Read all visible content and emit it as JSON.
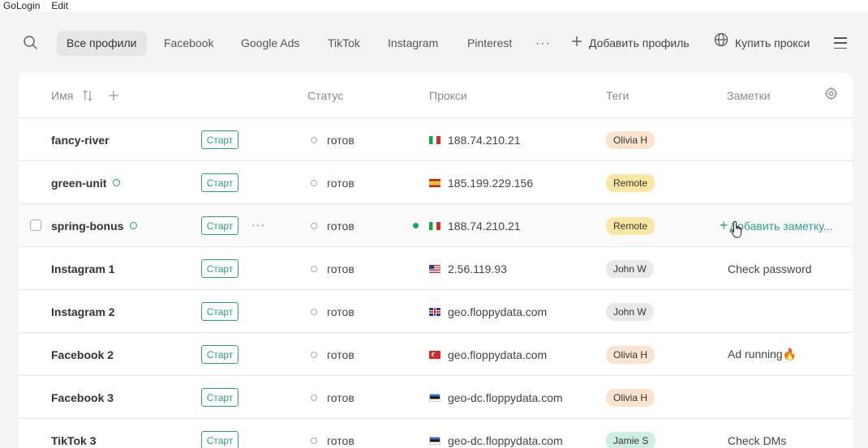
{
  "menubar": {
    "app": "GoLogin",
    "edit": "Edit"
  },
  "nav": {
    "tabs": [
      "Все профили",
      "Facebook",
      "Google Ads",
      "TikTok",
      "Instagram",
      "Pinterest"
    ],
    "more": "···",
    "add_profile": "Добавить профиль",
    "buy_proxy": "Купить прокси"
  },
  "table": {
    "headers": {
      "name": "Имя",
      "status": "Статус",
      "proxy": "Прокси",
      "tags": "Теги",
      "notes": "Заметки"
    },
    "start_label": "Старт",
    "add_note_label": "Добавить заметку...",
    "rows": [
      {
        "name": "fancy-river",
        "status": "готов",
        "proxy": "188.74.210.21",
        "flag": "it",
        "tag": "Olivia H",
        "tag_color": "#fbe3cf",
        "note": "",
        "online": false
      },
      {
        "name": "green-unit",
        "status": "готов",
        "proxy": "185.199.229.156",
        "flag": "es",
        "tag": "Remote",
        "tag_color": "#fbe7a2",
        "note": "",
        "online": true
      },
      {
        "name": "spring-bonus",
        "status": "готов",
        "proxy": "188.74.210.21",
        "flag": "it",
        "tag": "Remote",
        "tag_color": "#fbe7a2",
        "note": "",
        "online": true
      },
      {
        "name": "Instagram 1",
        "status": "готов",
        "proxy": "2.56.119.93",
        "flag": "us",
        "tag": "John W",
        "tag_color": "#e9e9ea",
        "note": "Check password",
        "online": false
      },
      {
        "name": "Instagram 2",
        "status": "готов",
        "proxy": "geo.floppydata.com",
        "flag": "gb",
        "tag": "John W",
        "tag_color": "#e9e9ea",
        "note": "",
        "online": false
      },
      {
        "name": "Facebook 2",
        "status": "готов",
        "proxy": "geo.floppydata.com",
        "flag": "tr",
        "tag": "Olivia H",
        "tag_color": "#fbe3cf",
        "note": "Ad running🔥",
        "online": false
      },
      {
        "name": "Facebook 3",
        "status": "готов",
        "proxy": "geo-dc.floppydata.com",
        "flag": "ee",
        "tag": "Olivia H",
        "tag_color": "#fbe3cf",
        "note": "",
        "online": false
      },
      {
        "name": "TikTok 3",
        "status": "готов",
        "proxy": "geo-dc.floppydata.com",
        "flag": "ee",
        "tag": "Jamie S",
        "tag_color": "#cdeee2",
        "note": "Check DMs",
        "online": false
      }
    ]
  }
}
